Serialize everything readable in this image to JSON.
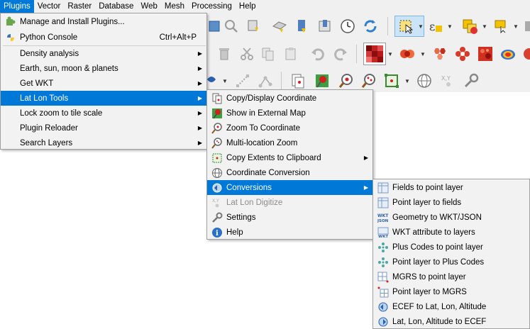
{
  "menubar": {
    "items": [
      "Plugins",
      "Vector",
      "Raster",
      "Database",
      "Web",
      "Mesh",
      "Processing",
      "Help"
    ],
    "active": "Plugins"
  },
  "plugins_menu": {
    "items": [
      {
        "label": "Manage and Install Plugins...",
        "icon": "puzzle-plugin-icon"
      },
      {
        "label": "Python Console",
        "shortcut": "Ctrl+Alt+P",
        "icon": "python-icon"
      },
      {
        "label": "Density analysis",
        "submenu": true
      },
      {
        "label": "Earth, sun, moon & planets",
        "submenu": true
      },
      {
        "label": "Get WKT",
        "submenu": true
      },
      {
        "label": "Lat Lon Tools",
        "submenu": true,
        "selected": true
      },
      {
        "label": "Lock zoom to tile scale",
        "submenu": true
      },
      {
        "label": "Plugin Reloader",
        "submenu": true
      },
      {
        "label": "Search Layers",
        "submenu": true
      }
    ]
  },
  "latlon_menu": {
    "items": [
      {
        "label": "Copy/Display Coordinate",
        "icon": "copy-coordinate-icon"
      },
      {
        "label": "Show in External Map",
        "icon": "pushpin-icon"
      },
      {
        "label": "Zoom To Coordinate",
        "icon": "zoom-coordinate-icon"
      },
      {
        "label": "Multi-location Zoom",
        "icon": "multi-zoom-icon"
      },
      {
        "label": "Copy Extents to Clipboard",
        "icon": "extents-icon",
        "submenu": true
      },
      {
        "label": "Coordinate Conversion",
        "icon": "globe-icon"
      },
      {
        "label": "Conversions",
        "icon": "conversions-icon",
        "submenu": true,
        "selected": true
      },
      {
        "label": "Lat Lon Digitize",
        "icon": "digitize-icon",
        "disabled": true
      },
      {
        "label": "Settings",
        "icon": "wrench-icon"
      },
      {
        "label": "Help",
        "icon": "help-icon"
      }
    ]
  },
  "conversions_menu": {
    "items": [
      {
        "label": "Fields to point layer",
        "icon": "table-icon"
      },
      {
        "label": "Point layer to fields",
        "icon": "table-icon"
      },
      {
        "label": "Geometry to WKT/JSON",
        "icon": "wkt-json-icon"
      },
      {
        "label": "WKT attribute to layers",
        "icon": "wkt-icon"
      },
      {
        "label": "Plus Codes to point layer",
        "icon": "plus-codes-icon"
      },
      {
        "label": "Point layer to Plus Codes",
        "icon": "plus-codes-icon"
      },
      {
        "label": "MGRS to point layer",
        "icon": "mgrs-icon"
      },
      {
        "label": "Point layer to MGRS",
        "icon": "mgrs-icon"
      },
      {
        "label": "ECEF to Lat, Lon, Altitude",
        "icon": "ecef-icon"
      },
      {
        "label": "Lat, Lon, Altitude to ECEF",
        "icon": "ecef-icon"
      }
    ]
  },
  "colors": {
    "selection": "#0078d7",
    "menu_bg": "#f2f2f2",
    "toolbar_bg": "#f0f0f0"
  }
}
